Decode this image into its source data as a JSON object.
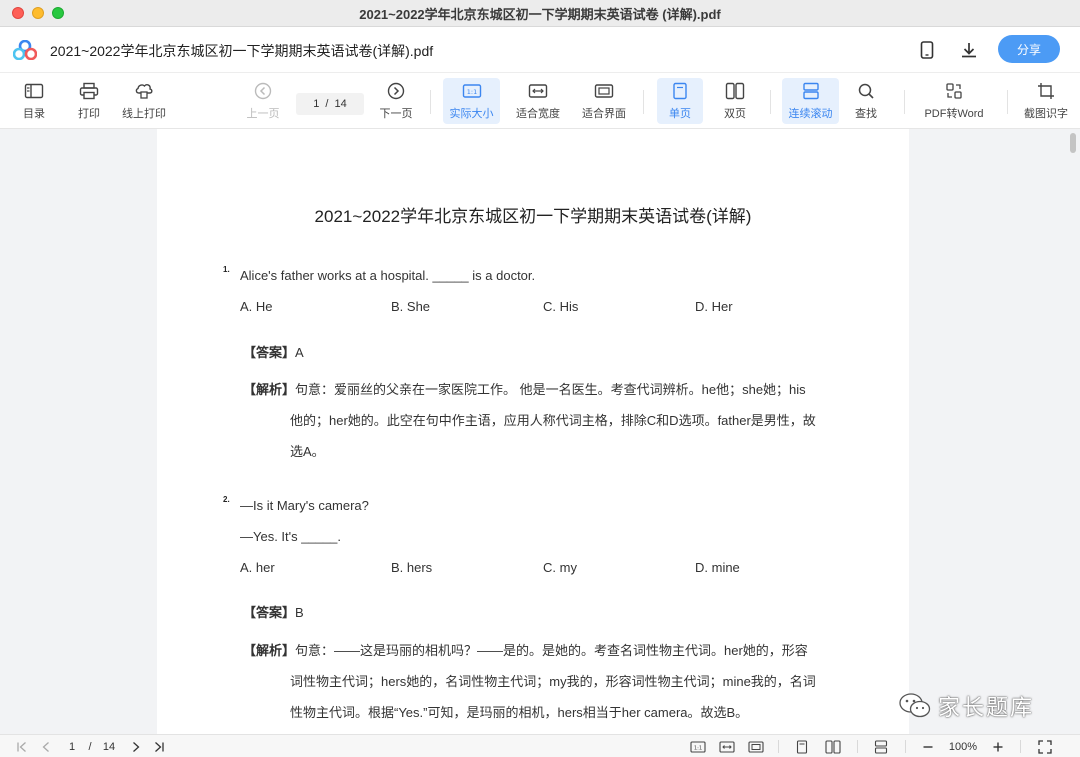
{
  "window": {
    "title": "2021~2022学年北京东城区初一下学期期末英语试卷 (详解).pdf"
  },
  "header": {
    "doc_title": "2021~2022学年北京东城区初一下学期期末英语试卷(详解).pdf",
    "share_label": "分享"
  },
  "toolbar": {
    "toc": "目录",
    "print": "打印",
    "online_print": "线上打印",
    "prev_page": "上一页",
    "current_page": "1",
    "page_sep": "/",
    "total_pages": "14",
    "next_page": "下一页",
    "actual_size": "实际大小",
    "fit_width": "适合宽度",
    "fit_page": "适合界面",
    "single_page": "单页",
    "double_page": "双页",
    "continuous_scroll": "连续滚动",
    "find": "查找",
    "pdf_to_word": "PDF转Word",
    "screenshot_ocr": "截图识字"
  },
  "document": {
    "title": "2021~2022学年北京东城区初一下学期期末英语试卷(详解)",
    "questions": [
      {
        "number": "1.",
        "lines": [
          "Alice's father works at a hospital. _____ is a doctor."
        ],
        "options": [
          "A. He",
          "B. She",
          "C. His",
          "D. Her"
        ],
        "answer_tag": "【答案】",
        "answer": "A",
        "explain_tag": "【解析】",
        "explain_lines": [
          "句意：爱丽丝的父亲在一家医院工作。 他是一名医生。考查代词辨析。he他；she她；his",
          "他的；her她的。此空在句中作主语，应用人称代词主格，排除C和D选项。father是男性，故",
          "选A。"
        ]
      },
      {
        "number": "2.",
        "lines": [
          "—Is it Mary's camera?",
          "—Yes. It's _____."
        ],
        "options": [
          "A. her",
          "B. hers",
          "C. my",
          "D. mine"
        ],
        "answer_tag": "【答案】",
        "answer": "B",
        "explain_tag": "【解析】",
        "explain_lines": [
          "句意：——这是玛丽的相机吗？——是的。是她的。考查名词性物主代词。her她的，形容",
          "词性物主代词；hers她的，名词性物主代词；my我的，形容词性物主代词；mine我的，名词",
          "性物主代词。根据“Yes.”可知，是玛丽的相机，hers相当于her camera。故选B。"
        ]
      }
    ]
  },
  "watermark": {
    "text": "家长题库"
  },
  "statusbar": {
    "current_page": "1",
    "page_sep": "/",
    "total_pages": "14",
    "zoom": "100%"
  },
  "colors": {
    "accent": "#4c9bf5",
    "active_bg": "#e6f0fd",
    "viewer_bg": "#f2f3f5"
  }
}
